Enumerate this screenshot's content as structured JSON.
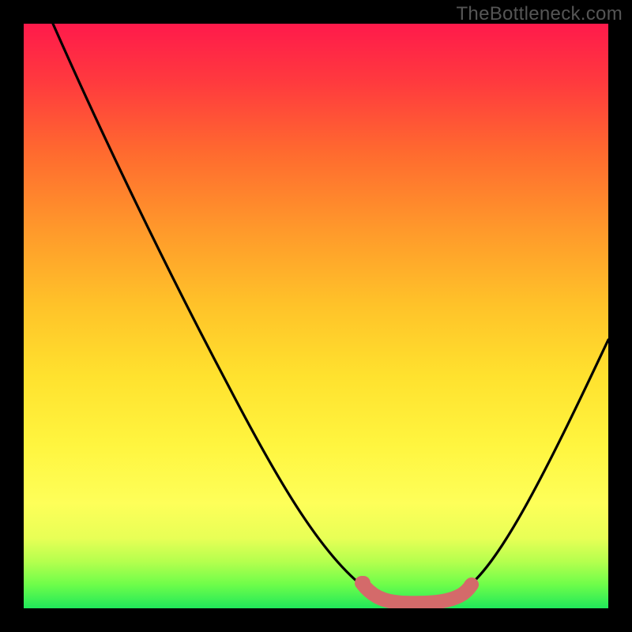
{
  "watermark": "TheBottleneck.com",
  "chart_data": {
    "type": "line",
    "title": "",
    "xlabel": "",
    "ylabel": "",
    "xlim": [
      0,
      100
    ],
    "ylim": [
      0,
      100
    ],
    "series": [
      {
        "name": "bottleneck-curve",
        "x": [
          5,
          10,
          15,
          20,
          25,
          30,
          35,
          40,
          45,
          50,
          55,
          60,
          62,
          65,
          68,
          72,
          75,
          80,
          85,
          90,
          95,
          100
        ],
        "values": [
          100,
          92,
          84,
          76,
          68,
          59,
          51,
          42,
          33,
          24,
          15,
          6,
          3,
          1,
          1,
          1,
          3,
          9,
          17,
          26,
          36,
          46
        ]
      },
      {
        "name": "valley-highlight",
        "x": [
          58,
          60,
          62,
          65,
          68,
          71,
          74,
          76
        ],
        "values": [
          5,
          3,
          2,
          1,
          1,
          1,
          2,
          3
        ]
      }
    ],
    "colors": {
      "curve": "#000000",
      "highlight": "#d86a6a",
      "gradient_top": "#ff1a4b",
      "gradient_bottom": "#20e85a"
    }
  }
}
